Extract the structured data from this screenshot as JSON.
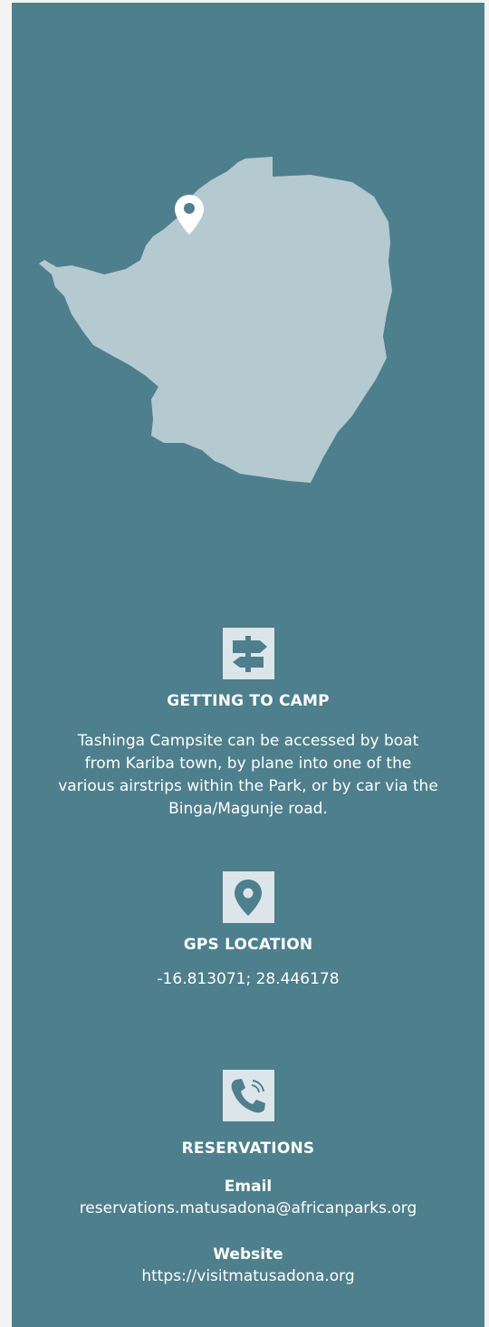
{
  "colors": {
    "panel_background": "#4e7f8c",
    "page_background": "#f4f4f4",
    "map_fill": "#b5c9d1",
    "icon_box": "#dce6ea",
    "text": "#ffffff"
  },
  "map": {
    "region_icon": "country-map-shape",
    "marker_icon": "map-pin-icon"
  },
  "getting_to_camp": {
    "icon": "signpost-icon",
    "heading": "GETTING TO CAMP",
    "text": "Tashinga Campsite can be accessed by boat from Kariba town, by plane into one of the various airstrips within the Park, or by car via the Binga/Magunje road."
  },
  "gps": {
    "icon": "location-pin-icon",
    "heading": "GPS LOCATION",
    "value": "-16.813071; 28.446178"
  },
  "reservations": {
    "icon": "phone-icon",
    "heading": "RESERVATIONS",
    "email_label": "Email",
    "email_value": "reservations.matusadona@africanparks.org",
    "website_label": "Website",
    "website_value": "https://visitmatusadona.org"
  }
}
